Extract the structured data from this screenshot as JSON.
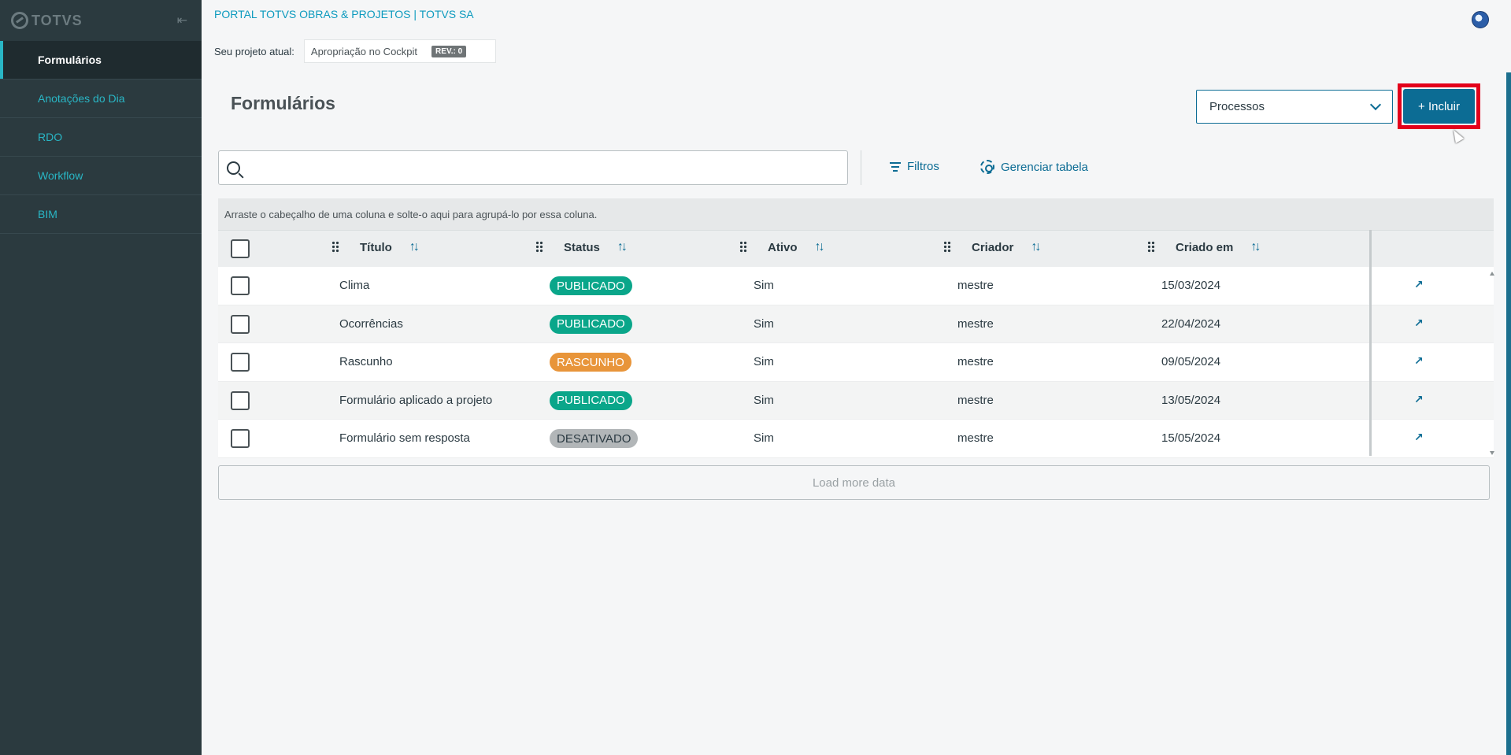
{
  "brand": {
    "logo_text": "TOTVS"
  },
  "sidebar": {
    "items": [
      {
        "label": "Formulários",
        "active": true
      },
      {
        "label": "Anotações do Dia",
        "active": false
      },
      {
        "label": "RDO",
        "active": false
      },
      {
        "label": "Workflow",
        "active": false
      },
      {
        "label": "BIM",
        "active": false
      }
    ]
  },
  "header": {
    "portal_title": "PORTAL TOTVS OBRAS & PROJETOS | TOTVS SA",
    "project_label": "Seu projeto atual:",
    "project_name": "Apropriação no Cockpit",
    "project_rev": "REV.: 0"
  },
  "page": {
    "title": "Formulários",
    "processos_select": "Processos",
    "incluir_label": "+ Incluir"
  },
  "toolbar": {
    "search_value": "",
    "filtros_label": "Filtros",
    "gerenciar_label": "Gerenciar tabela"
  },
  "table": {
    "group_hint": "Arraste o cabeçalho de uma coluna e solte-o aqui para agrupá-lo por essa coluna.",
    "columns": [
      "Título",
      "Status",
      "Ativo",
      "Criador",
      "Criado em"
    ],
    "rows": [
      {
        "titulo": "Clima",
        "status": "PUBLICADO",
        "ativo": "Sim",
        "criador": "mestre",
        "criado_em": "15/03/2024"
      },
      {
        "titulo": "Ocorrências",
        "status": "PUBLICADO",
        "ativo": "Sim",
        "criador": "mestre",
        "criado_em": "22/04/2024"
      },
      {
        "titulo": "Rascunho",
        "status": "RASCUNHO",
        "ativo": "Sim",
        "criador": "mestre",
        "criado_em": "09/05/2024"
      },
      {
        "titulo": "Formulário aplicado a projeto",
        "status": "PUBLICADO",
        "ativo": "Sim",
        "criador": "mestre",
        "criado_em": "13/05/2024"
      },
      {
        "titulo": "Formulário sem resposta",
        "status": "DESATIVADO",
        "ativo": "Sim",
        "criador": "mestre",
        "criado_em": "15/05/2024"
      }
    ],
    "load_more": "Load more data"
  },
  "colors": {
    "publicado": "#0aa68a",
    "rascunho": "#e8953a",
    "desativado": "#b2b6b8",
    "accent": "#0c6c94",
    "highlight": "#e3001b"
  }
}
